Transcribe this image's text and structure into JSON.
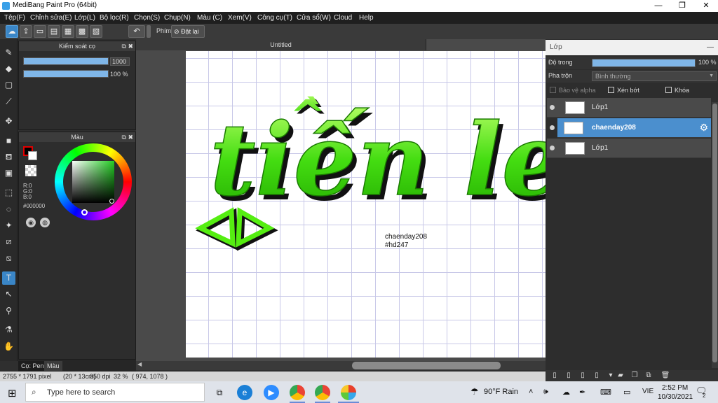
{
  "app": {
    "title": "MediBang Paint Pro (64bit)",
    "window_controls": [
      "—",
      "❐",
      "✕"
    ]
  },
  "menu": [
    "Tệp(F)",
    "Chỉnh sửa(E)",
    "Lớp(L)",
    "Bộ lọc(R)",
    "Chọn(S)",
    "Chụp(N)",
    "Màu (C)",
    "Xem(V)",
    "Công cụ(T)",
    "Cửa sổ(W)",
    "Cloud",
    "Help"
  ],
  "toolbar": {
    "undo_icon": "undo-icon",
    "shortcut_label": "Phím",
    "reset_label": "Đặt lại"
  },
  "brush_panel": {
    "title": "Kiểm soát cọ",
    "size_value": "1000",
    "opacity_value": "100 %",
    "size_fraction": 1.0,
    "opacity_fraction": 1.0
  },
  "color_panel": {
    "title": "Màu",
    "r": "R:0",
    "g": "G:0",
    "b": "B:0",
    "hex": "#000000",
    "primary_color": "#ff0000",
    "current_color": "#000000"
  },
  "document": {
    "tab_title": "Untitled",
    "text_line1": "chaenday208",
    "text_line2": "#hd247",
    "art_text": "tiến len",
    "art_accent": "^̀"
  },
  "left_bottom_tabs": [
    "Cọ: Pen",
    "Màu"
  ],
  "status": {
    "size": "2755 * 1791 pixel",
    "physical": "(20 * 13cm)",
    "dpi": "350 dpi",
    "zoom": "32 %",
    "coords": "( 974, 1078 )"
  },
  "layer_panel": {
    "title": "Lớp",
    "opacity_label": "Độ trong",
    "opacity_value": "100 %",
    "opacity_fraction": 1.0,
    "blend_label": "Pha trộn",
    "blend_value": "Bình thường",
    "protect_alpha": "Bảo vệ alpha",
    "clipping": "Xén bớt",
    "lock": "Khóa",
    "layers": [
      {
        "name": "Lớp1",
        "selected": false
      },
      {
        "name": "chaenday208",
        "selected": true
      },
      {
        "name": "Lớp1",
        "selected": false
      }
    ]
  },
  "taskbar": {
    "search_placeholder": "Type here to search",
    "weather": "90°F  Rain",
    "lang": "VIE",
    "time": "2:52 PM",
    "date": "10/30/2021",
    "notification_count": "2"
  }
}
